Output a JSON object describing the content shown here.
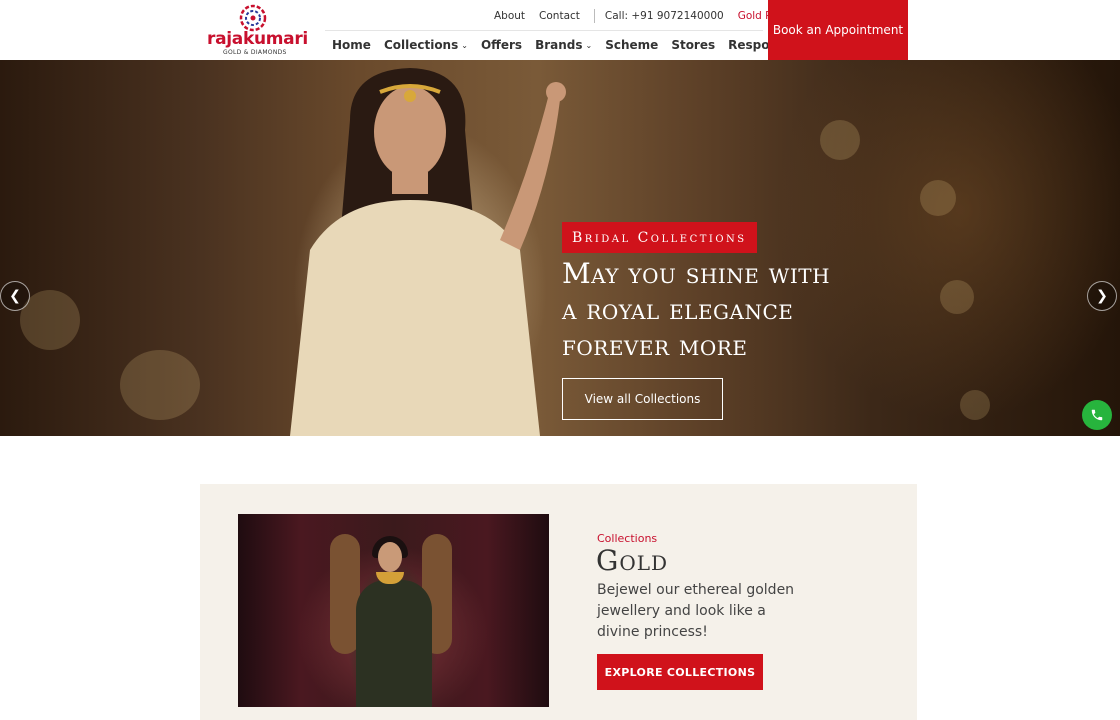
{
  "brand": {
    "name": "rajakumari",
    "tagline": "GOLD & DIAMONDS",
    "accent_color": "#d0121b"
  },
  "topbar": {
    "about": "About",
    "contact": "Contact",
    "call": "Call: +91 9072140000",
    "gold_rate": "Gold Rate"
  },
  "nav": {
    "items": [
      {
        "label": "Home",
        "has_dropdown": false
      },
      {
        "label": "Collections",
        "has_dropdown": true
      },
      {
        "label": "Offers",
        "has_dropdown": false
      },
      {
        "label": "Brands",
        "has_dropdown": true
      },
      {
        "label": "Scheme",
        "has_dropdown": false
      },
      {
        "label": "Stores",
        "has_dropdown": false
      },
      {
        "label": "Responsibilities",
        "has_dropdown": false
      }
    ],
    "cta": "Book an Appointment"
  },
  "hero": {
    "badge": "Bridal Collections",
    "title_lines": [
      "May you shine with",
      "a royal elegance",
      "forever more"
    ],
    "button": "View all Collections",
    "prev_icon": "chevron-left-icon",
    "next_icon": "chevron-right-icon"
  },
  "collection": {
    "label": "Collections",
    "title": "Gold",
    "description": "Bejewel our ethereal golden jewellery and look like a divine princess!",
    "button": "EXPLORE COLLECTIONS"
  },
  "fab": {
    "icon": "phone-icon",
    "color": "#27b43d"
  }
}
